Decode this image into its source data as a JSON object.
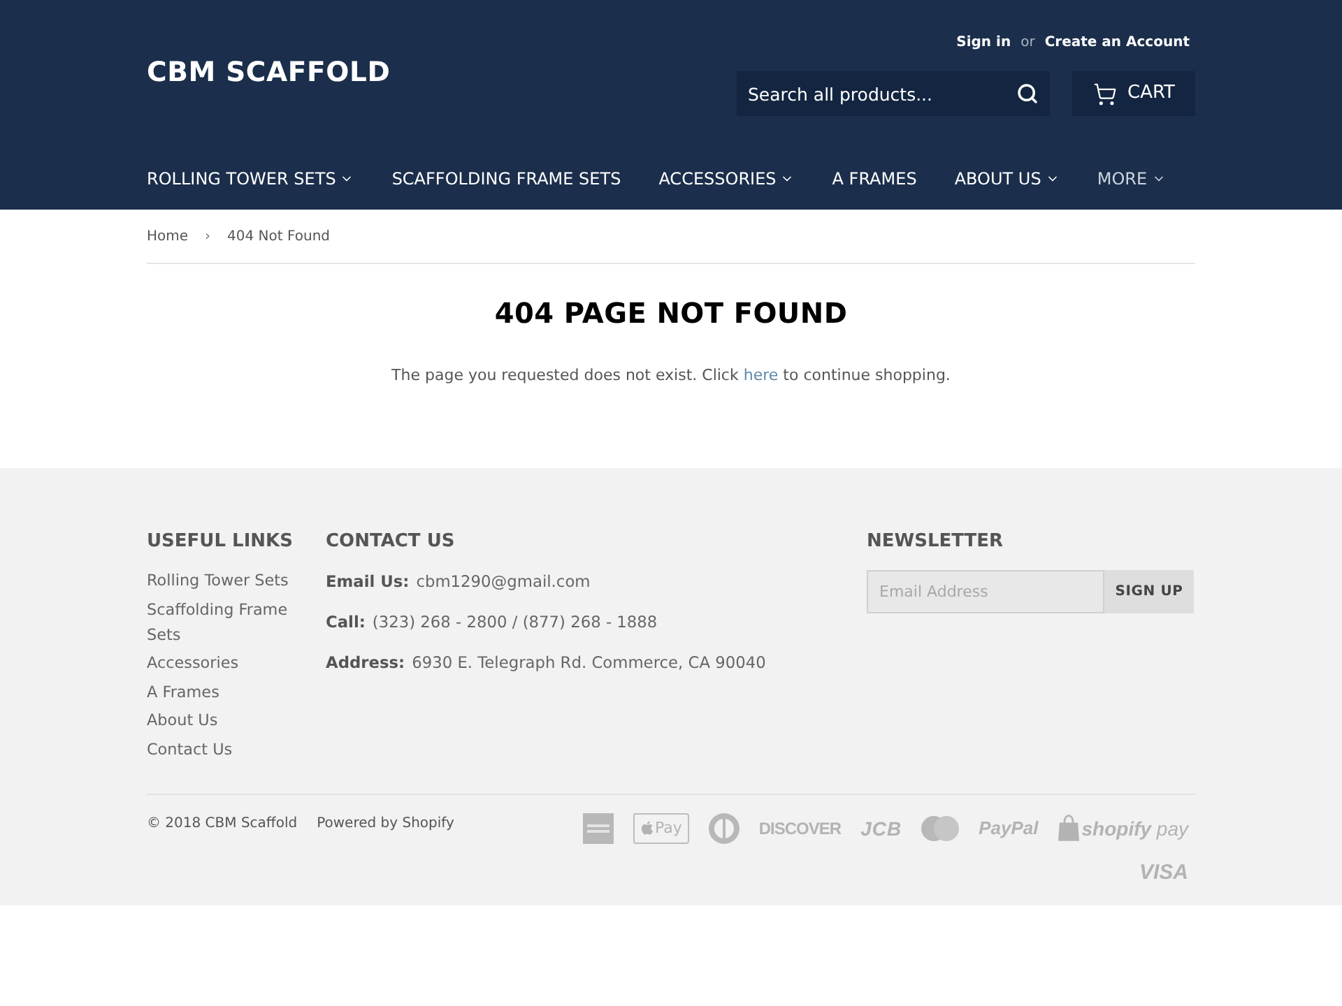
{
  "header": {
    "account_links": [
      {
        "label": "Sign in",
        "kind": "link"
      },
      {
        "label": "or",
        "kind": "text"
      },
      {
        "label": "Create an Account",
        "kind": "link"
      }
    ],
    "logo": "CBM SCAFFOLD",
    "search": {
      "placeholder": "Search all products..."
    },
    "cart": {
      "label": "CART"
    }
  },
  "nav": [
    {
      "label": "ROLLING TOWER SETS",
      "dropdown": true,
      "kind": "link"
    },
    {
      "label": "SCAFFOLDING FRAME SETS",
      "dropdown": false,
      "kind": "link"
    },
    {
      "label": "ACCESSORIES",
      "dropdown": true,
      "kind": "link"
    },
    {
      "label": "A FRAMES",
      "dropdown": false,
      "kind": "link"
    },
    {
      "label": "ABOUT US",
      "dropdown": true,
      "kind": "link"
    },
    {
      "label": "MORE",
      "dropdown": true,
      "kind": "more"
    }
  ],
  "breadcrumb": [
    {
      "label": "Home",
      "kind": "link"
    },
    {
      "label": "›",
      "kind": "separator"
    },
    {
      "label": "404 Not Found",
      "kind": "current"
    }
  ],
  "main": {
    "title": "404 PAGE NOT FOUND",
    "message": {
      "before": "The page you requested does not exist. Click",
      "link": "here",
      "after": "to continue shopping."
    }
  },
  "footer": {
    "useful_links": {
      "title": "USEFUL LINKS",
      "items": [
        "Rolling Tower Sets",
        "Scaffolding Frame Sets",
        "Accessories",
        "A Frames",
        "About Us",
        "Contact Us"
      ]
    },
    "contact": {
      "title": "CONTACT US",
      "lines": [
        {
          "label": "Email Us:",
          "value": "cbm1290@gmail.com"
        },
        {
          "label": "Call:",
          "value": "(323) 268 - 2800 / (877) 268 - 1888"
        },
        {
          "label": "Address:",
          "value": "6930 E. Telegraph Rd. Commerce, CA 90040"
        }
      ]
    },
    "newsletter": {
      "title": "NEWSLETTER",
      "placeholder": "Email Address",
      "button": "SIGN UP"
    },
    "copyright": "© 2018 CBM Scaffold",
    "powered_by": "Powered by Shopify",
    "payment_methods": [
      {
        "kind": "amex"
      },
      {
        "kind": "apple_pay",
        "label": "Pay"
      },
      {
        "kind": "diners"
      },
      {
        "kind": "discover",
        "label": "DISCOVER"
      },
      {
        "kind": "jcb",
        "label": "JCB"
      },
      {
        "kind": "mastercard"
      },
      {
        "kind": "paypal",
        "label": "PayPal"
      },
      {
        "kind": "shopify_pay",
        "label": "**shopify** pay"
      },
      {
        "kind": "visa",
        "label": "VISA"
      }
    ]
  }
}
